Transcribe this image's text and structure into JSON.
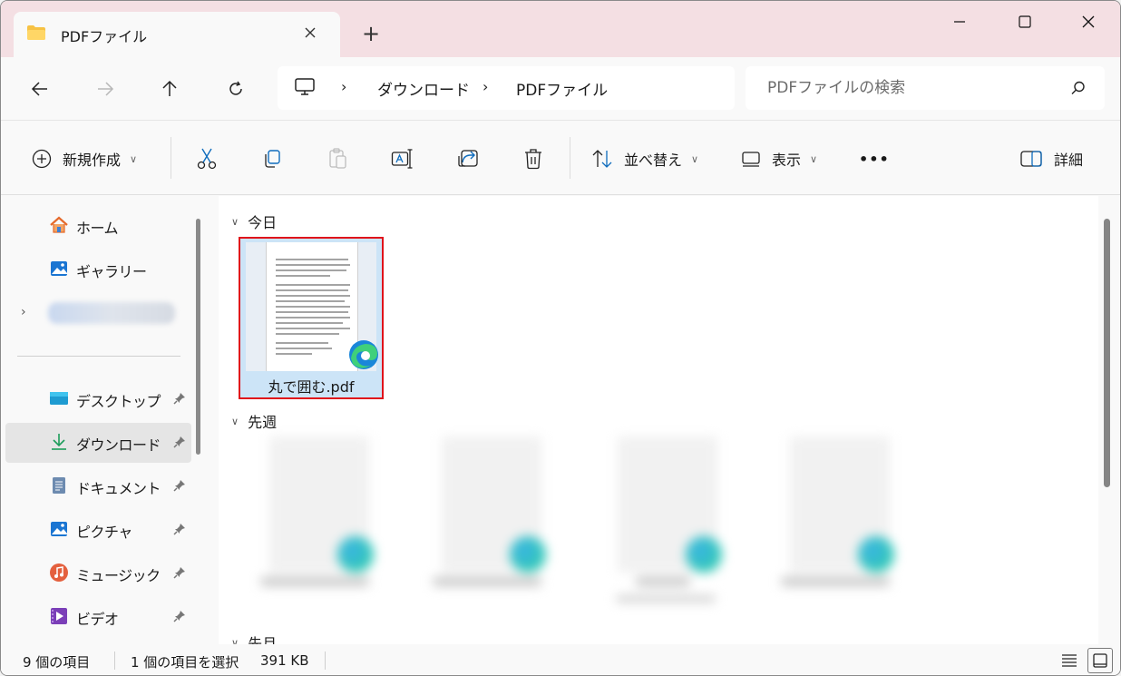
{
  "window": {
    "tab_title": "PDFファイル",
    "new_tab_symbol": "+",
    "controls": {
      "minimize": "minimize-icon",
      "maximize": "maximize-icon",
      "close": "close-icon"
    }
  },
  "nav": {
    "breadcrumb": [
      "ダウンロード",
      "PDFファイル"
    ],
    "separator": "›",
    "search_placeholder": "PDFファイルの検索"
  },
  "commands": {
    "new": "新規作成",
    "sort": "並べ替え",
    "view": "表示",
    "more": "•••",
    "details": "詳細"
  },
  "sidebar": {
    "items": [
      {
        "label": "ホーム",
        "icon": "home-icon"
      },
      {
        "label": "ギャラリー",
        "icon": "gallery-icon"
      },
      {
        "label": "デスクトップ",
        "icon": "desktop-icon",
        "pinned": true
      },
      {
        "label": "ダウンロード",
        "icon": "download-icon",
        "pinned": true,
        "selected": true
      },
      {
        "label": "ドキュメント",
        "icon": "document-icon",
        "pinned": true
      },
      {
        "label": "ピクチャ",
        "icon": "pictures-icon",
        "pinned": true
      },
      {
        "label": "ミュージック",
        "icon": "music-icon",
        "pinned": true
      },
      {
        "label": "ビデオ",
        "icon": "video-icon",
        "pinned": true
      }
    ]
  },
  "content": {
    "groups": [
      {
        "label": "今日"
      },
      {
        "label": "先週"
      },
      {
        "label": "先月"
      }
    ],
    "selected_file": {
      "name": "丸で囲む.pdf",
      "badge": "edge-icon"
    }
  },
  "status": {
    "item_count": "9 個の項目",
    "selection": "1 個の項目を選択",
    "size": "391 KB"
  },
  "colors": {
    "titlebar": "#f4dfe3",
    "selection_fill": "#cce4f7",
    "highlight_border": "#e0131b"
  }
}
